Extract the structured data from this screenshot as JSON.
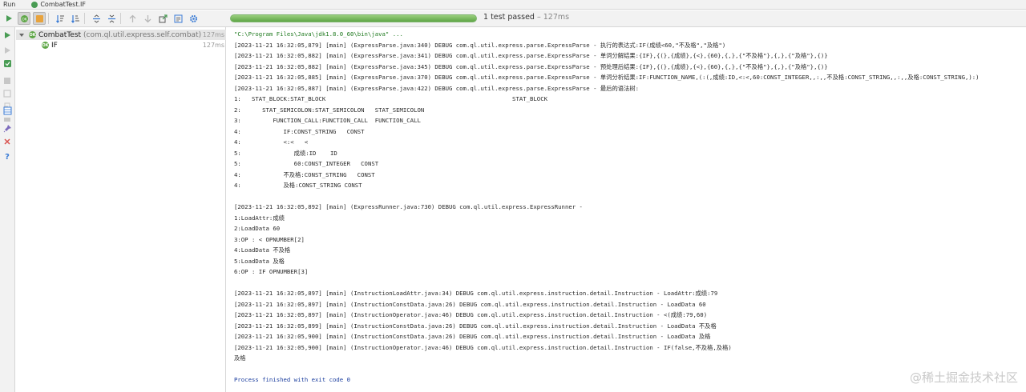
{
  "titlebar": {
    "run_label": "Run",
    "tab_title": "CombatTest.IF"
  },
  "progress": {
    "status": "1 test passed",
    "separator": " – ",
    "time": "127ms",
    "fraction": 1.0,
    "color": "#5ea646"
  },
  "toolbar": {
    "buttons": [
      "run-icon",
      "show-passed-icon",
      "show-ignored-icon",
      "sort-alpha-icon",
      "sort-duration-icon",
      "expand-all-icon",
      "collapse-all-icon",
      "prev-failed-icon",
      "next-failed-icon",
      "export-icon",
      "import-icon",
      "settings-icon"
    ]
  },
  "left_strip": {
    "buttons": [
      "rerun-icon",
      "rerun-failed-icon",
      "toggle-auto-test-icon",
      "stop-icon",
      "dump-threads-icon",
      "exit-icon",
      "print-icon",
      "layout-icon",
      "pin-icon",
      "close-icon",
      "help-icon"
    ]
  },
  "tree": {
    "root": {
      "name": "CombatTest",
      "package": "(com.ql.util.express.self.combat)",
      "duration": "127ms"
    },
    "child": {
      "name": "IF",
      "duration": "127ms"
    }
  },
  "console": {
    "lines": [
      "\"C:\\Program Files\\Java\\jdk1.8.0_60\\bin\\java\" ...",
      "[2023-11-21 16:32:05,879] [main] (ExpressParse.java:340) DEBUG com.ql.util.express.parse.ExpressParse - 执行的表达式:IF(成绩<60,\"不及格\",\"及格\")",
      "[2023-11-21 16:32:05,882] [main] (ExpressParse.java:341) DEBUG com.ql.util.express.parse.ExpressParse - 单词分解结果:{IF},{(},{成绩},{<},{60},{,},{\"不及格\"},{,},{\"及格\"},{)}",
      "[2023-11-21 16:32:05,882] [main] (ExpressParse.java:345) DEBUG com.ql.util.express.parse.ExpressParse - 预处理后结果:{IF},{(},{成绩},{<},{60},{,},{\"不及格\"},{,},{\"及格\"},{)}",
      "[2023-11-21 16:32:05,885] [main] (ExpressParse.java:370) DEBUG com.ql.util.express.parse.ExpressParse - 单词分析结果:IF:FUNCTION_NAME,(:(,成绩:ID,<:<,60:CONST_INTEGER,,:,,不及格:CONST_STRING,,:,,及格:CONST_STRING,):)",
      "[2023-11-21 16:32:05,887] [main] (ExpressParse.java:422) DEBUG com.ql.util.express.parse.ExpressParse - 最后的语法树:",
      "1:   STAT_BLOCK:STAT_BLOCK                                                     STAT_BLOCK",
      "2:      STAT_SEMICOLON:STAT_SEMICOLON   STAT_SEMICOLON",
      "3:         FUNCTION_CALL:FUNCTION_CALL  FUNCTION_CALL",
      "4:            IF:CONST_STRING   CONST",
      "4:            <:<   <",
      "5:               成绩:ID    ID",
      "5:               60:CONST_INTEGER   CONST",
      "4:            不及格:CONST_STRING   CONST",
      "4:            及格:CONST_STRING CONST",
      "",
      "[2023-11-21 16:32:05,892] [main] (ExpressRunner.java:730) DEBUG com.ql.util.express.ExpressRunner -",
      "1:LoadAttr:成绩",
      "2:LoadData 60",
      "3:OP : < OPNUMBER[2]",
      "4:LoadData 不及格",
      "5:LoadData 及格",
      "6:OP : IF OPNUMBER[3]",
      "",
      "[2023-11-21 16:32:05,897] [main] (InstructionLoadAttr.java:34) DEBUG com.ql.util.express.instruction.detail.Instruction - LoadAttr:成绩:79",
      "[2023-11-21 16:32:05,897] [main] (InstructionConstData.java:26) DEBUG com.ql.util.express.instruction.detail.Instruction - LoadData 60",
      "[2023-11-21 16:32:05,897] [main] (InstructionOperator.java:46) DEBUG com.ql.util.express.instruction.detail.Instruction - <(成绩:79,60)",
      "[2023-11-21 16:32:05,899] [main] (InstructionConstData.java:26) DEBUG com.ql.util.express.instruction.detail.Instruction - LoadData 不及格",
      "[2023-11-21 16:32:05,900] [main] (InstructionConstData.java:26) DEBUG com.ql.util.express.instruction.detail.Instruction - LoadData 及格",
      "[2023-11-21 16:32:05,900] [main] (InstructionOperator.java:46) DEBUG com.ql.util.express.instruction.detail.Instruction - IF(false,不及格,及格)",
      "及格",
      "",
      "Process finished with exit code 0"
    ]
  },
  "watermark": "@稀土掘金技术社区"
}
